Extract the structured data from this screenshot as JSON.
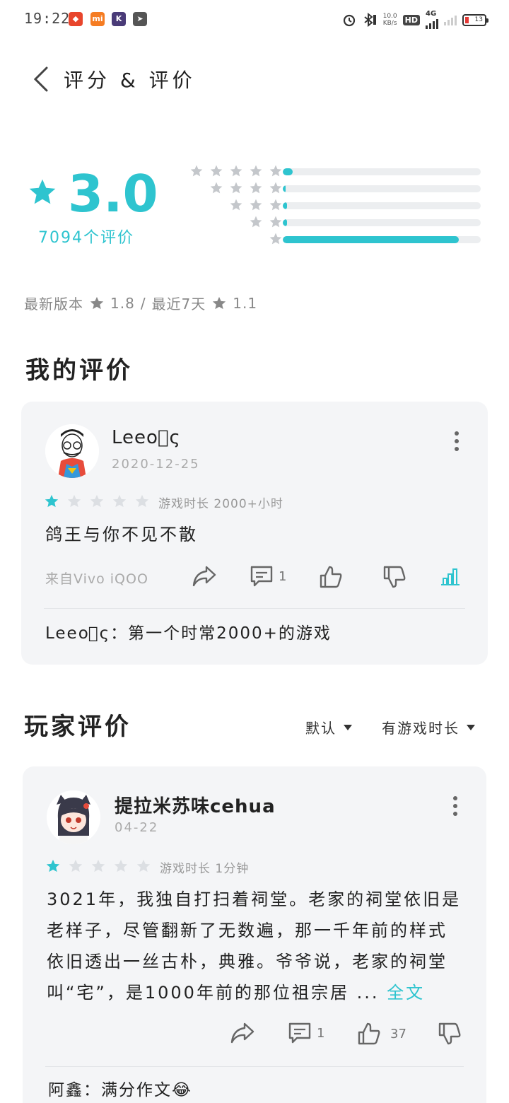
{
  "status_bar": {
    "time": "19:22",
    "apps": [
      "game-app-icon",
      "mi-app-icon",
      "k-app-icon",
      "telegram-icon"
    ],
    "net_speed_value": "10.0",
    "net_speed_unit": "KB/s",
    "hd_label": "HD",
    "network": "4G",
    "battery": "13"
  },
  "header": {
    "title": "评分 & 评价"
  },
  "rating": {
    "score": "3.0",
    "count_label": "7094个评价",
    "distribution": [
      {
        "stars": 5,
        "fraction": 0.05
      },
      {
        "stars": 4,
        "fraction": 0.01
      },
      {
        "stars": 3,
        "fraction": 0.02
      },
      {
        "stars": 2,
        "fraction": 0.02
      },
      {
        "stars": 1,
        "fraction": 0.89
      }
    ],
    "accent_color": "#2ec4cf"
  },
  "version": {
    "latest_label": "最新版本",
    "latest_score": "1.8",
    "separator": "/",
    "recent_label": "最近7天",
    "recent_score": "1.1"
  },
  "my_review": {
    "section_title": "我的评价",
    "user_name": "Leeo゚ς",
    "date": "2020-12-25",
    "stars": 1,
    "playtime": "游戏时长 2000+小时",
    "text": "鸽王与你不见不散",
    "device": "来自Vivo iQOO",
    "comment_count": "1",
    "reply": "Leeo゚ς：第一个时常2000+的游戏"
  },
  "player_reviews": {
    "section_title": "玩家评价",
    "filter_sort": "默认",
    "filter_playtime": "有游戏时长",
    "items": [
      {
        "user_name": "提拉米苏味cehua",
        "date": "04-22",
        "stars": 1,
        "playtime": "游戏时长 1分钟",
        "text_lines": [
          "3021年，我独自打扫着祠堂。老家的祠堂依旧是",
          "老样子，尽管翻新了无数遍，那一千年前的样式",
          "依旧透出一丝古朴，典雅。爷爷说，老家的祠堂",
          "叫“宅”，是1000年前的那位祖宗居 ..."
        ],
        "full_text_link": "全文",
        "comment_count": "1",
        "like_count": "37",
        "reply": "阿鑫：满分作文😂"
      }
    ]
  }
}
